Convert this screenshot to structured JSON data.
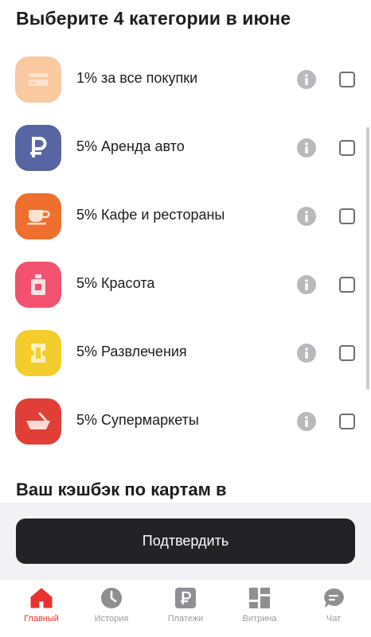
{
  "header": {
    "title": "Выберите 4 категории в июне"
  },
  "categories": [
    {
      "label": "1% за все покупки",
      "icon": "card-icon",
      "color": "#f9c9a0"
    },
    {
      "label": "5% Аренда авто",
      "icon": "ruble-icon",
      "color": "#5765a3"
    },
    {
      "label": "5% Кафе и рестораны",
      "icon": "cup-icon",
      "color": "#ef6f2e"
    },
    {
      "label": "5% Красота",
      "icon": "perfume-icon",
      "color": "#f2516f"
    },
    {
      "label": "5% Развлечения",
      "icon": "ticket-icon",
      "color": "#f3cd2d"
    },
    {
      "label": "5% Супермаркеты",
      "icon": "basket-icon",
      "color": "#df3f36"
    }
  ],
  "cashback": {
    "title": "Ваш кэшбэк по картам в"
  },
  "actions": {
    "confirm_label": "Подтвердить"
  },
  "tabbar": {
    "items": [
      {
        "label": "Главный",
        "icon": "home-icon",
        "active": true
      },
      {
        "label": "История",
        "icon": "clock-icon",
        "active": false
      },
      {
        "label": "Платежи",
        "icon": "ruble-square-icon",
        "active": false
      },
      {
        "label": "Витрина",
        "icon": "grid-icon",
        "active": false
      },
      {
        "label": "Чат",
        "icon": "chat-bubble-icon",
        "active": false
      }
    ]
  },
  "colors": {
    "accent": "#e8322c",
    "button_dark": "#232325",
    "panel_bg": "#f2f2f5"
  }
}
